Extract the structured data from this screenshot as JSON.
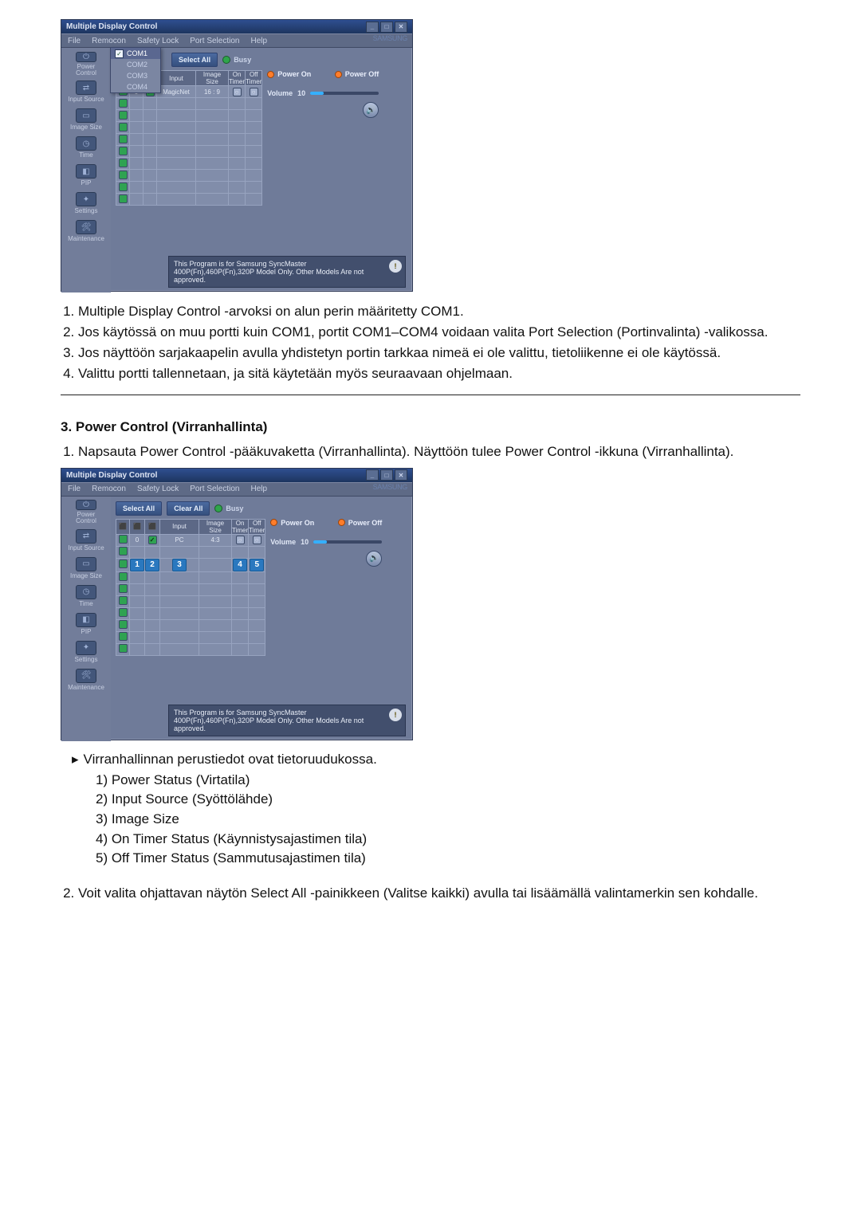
{
  "app": {
    "title": "Multiple Display Control",
    "menu": {
      "file": "File",
      "remocon": "Remocon",
      "safety": "Safety Lock",
      "port": "Port Selection",
      "help": "Help"
    },
    "logo": "SAMSUNG",
    "port_dropdown": {
      "com1": "COM1",
      "com2": "COM2",
      "com3": "COM3",
      "com4": "COM4"
    },
    "buttons": {
      "select_all": "Select All",
      "clear_all": "Clear All",
      "busy": "Busy"
    },
    "grid_headers": {
      "input": "Input",
      "magicnet": "MagicNet",
      "size": "Image Size",
      "ontime": "On Timer",
      "offtime": "Off Timer"
    },
    "grid_row0": {
      "id": "0",
      "sel": "0",
      "input": "PC",
      "size": "4:3",
      "size_top": "16 : 9"
    },
    "panel": {
      "power_on": "Power On",
      "power_off": "Power Off",
      "volume": "Volume",
      "vol_val": "10"
    },
    "foot": "This Program is for Samsung SyncMaster 400P(Fn),460P(Fn),320P  Model Only. Other Models Are not approved.",
    "side": {
      "power": "Power Control",
      "input": "Input Source",
      "image": "Image Size",
      "time": "Time",
      "pip": "PIP",
      "settings": "Settings",
      "maint": "Maintenance"
    }
  },
  "doc": {
    "list1": {
      "i1": "Multiple Display Control -arvoksi on alun perin määritetty COM1.",
      "i2": "Jos käytössä on muu portti kuin COM1, portit COM1–COM4 voidaan valita Port Selection (Portinvalinta) -valikossa.",
      "i3": "Jos näyttöön sarjakaapelin avulla yhdistetyn portin tarkkaa nimeä ei ole valittu, tietoliikenne ei ole käytössä.",
      "i4": "Valittu portti tallennetaan, ja sitä käytetään myös seuraavaan ohjelmaan."
    },
    "sect3": {
      "title": "3. Power Control (Virranhallinta)",
      "i1": "Napsauta Power Control -pääkuvaketta (Virranhallinta). Näyttöön tulee Power Control -ikkuna (Virranhallinta)."
    },
    "outro": {
      "lead": "Virranhallinnan perustiedot ovat tietoruudukossa.",
      "s1": "1) Power Status (Virtatila)",
      "s2": "2) Input Source (Syöttölähde)",
      "s3": "3) Image Size",
      "s4": "4) On Timer Status (Käynnistysajastimen tila)",
      "s5": "5) Off Timer Status (Sammutusajastimen tila)",
      "i2": "Voit valita ohjattavan näytön Select All -painikkeen (Valitse kaikki) avulla tai lisäämällä valintamerkin sen kohdalle."
    }
  }
}
